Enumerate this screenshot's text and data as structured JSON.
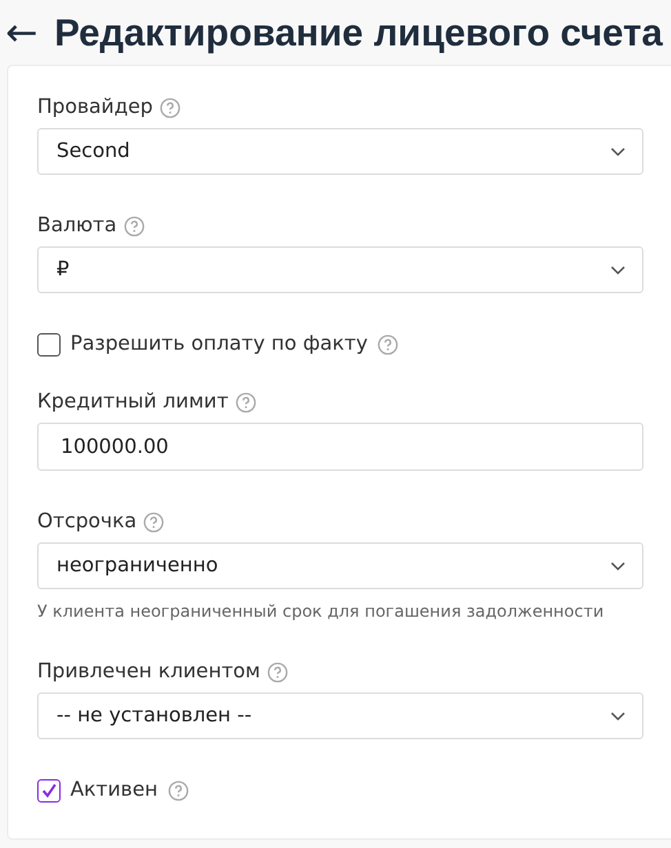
{
  "header": {
    "back_icon": "←",
    "title": "Редактирование лицевого счета"
  },
  "fields": [
    {
      "kind": "select",
      "label": "Провайдер",
      "value": "Second"
    },
    {
      "kind": "select",
      "label": "Валюта",
      "value": "₽"
    },
    {
      "kind": "checkbox",
      "label": "Разрешить оплату по факту",
      "checked": false
    },
    {
      "kind": "input",
      "label": "Кредитный лимит",
      "value": "100000.00"
    },
    {
      "kind": "select",
      "label": "Отсрочка",
      "value": "неограниченно",
      "hint": "У клиента неограниченный срок для погашения задолженности"
    },
    {
      "kind": "select",
      "label": "Привлечен клиентом",
      "value": "-- не установлен --"
    },
    {
      "kind": "checkbox",
      "label": "Активен",
      "checked": true
    }
  ]
}
